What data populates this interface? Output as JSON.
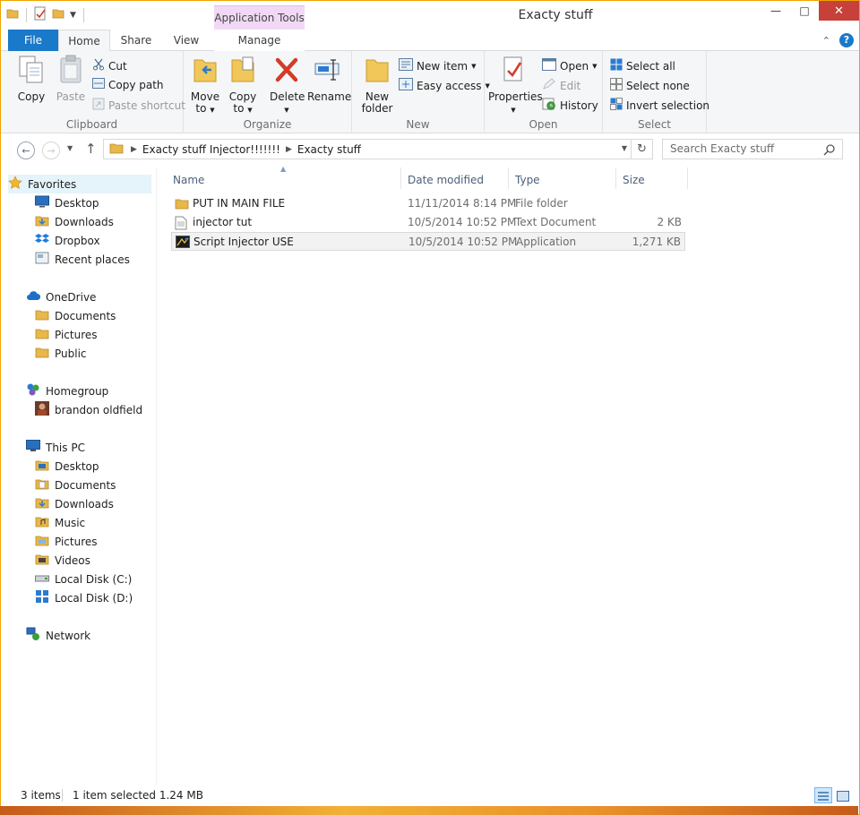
{
  "window": {
    "title": "Exacty stuff",
    "context_tab_group": "Application Tools"
  },
  "tabs": {
    "file": "File",
    "home": "Home",
    "share": "Share",
    "view": "View",
    "manage": "Manage"
  },
  "ribbon": {
    "clipboard": {
      "label": "Clipboard",
      "copy": "Copy",
      "paste": "Paste",
      "cut": "Cut",
      "copy_path": "Copy path",
      "paste_shortcut": "Paste shortcut"
    },
    "organize": {
      "label": "Organize",
      "move_to": "Move",
      "move_to_2": "to",
      "copy_to": "Copy",
      "copy_to_2": "to",
      "delete": "Delete",
      "rename": "Rename"
    },
    "new": {
      "label": "New",
      "new_folder": "New",
      "new_folder_2": "folder",
      "new_item": "New item",
      "easy_access": "Easy access"
    },
    "open": {
      "label": "Open",
      "properties": "Properties",
      "open": "Open",
      "edit": "Edit",
      "history": "History"
    },
    "select": {
      "label": "Select",
      "select_all": "Select all",
      "select_none": "Select none",
      "invert_selection": "Invert selection"
    }
  },
  "address": {
    "crumbs": [
      "Exacty stuff Injector!!!!!!!",
      "Exacty stuff"
    ],
    "search_placeholder": "Search Exacty stuff"
  },
  "sidebar": {
    "favorites": {
      "label": "Favorites",
      "items": [
        "Desktop",
        "Downloads",
        "Dropbox",
        "Recent places"
      ]
    },
    "onedrive": {
      "label": "OneDrive",
      "items": [
        "Documents",
        "Pictures",
        "Public"
      ]
    },
    "homegroup": {
      "label": "Homegroup",
      "items": [
        "brandon oldfield"
      ]
    },
    "thispc": {
      "label": "This PC",
      "items": [
        "Desktop",
        "Documents",
        "Downloads",
        "Music",
        "Pictures",
        "Videos",
        "Local Disk (C:)",
        "Local Disk (D:)"
      ]
    },
    "network": {
      "label": "Network"
    }
  },
  "columns": {
    "name": "Name",
    "date": "Date modified",
    "type": "Type",
    "size": "Size"
  },
  "files": [
    {
      "name": "PUT IN MAIN FILE",
      "date": "11/11/2014 8:14 PM",
      "type": "File folder",
      "size": "",
      "icon": "folder-icon"
    },
    {
      "name": "injector tut",
      "date": "10/5/2014 10:52 PM",
      "type": "Text Document",
      "size": "2 KB",
      "icon": "text-file-icon"
    },
    {
      "name": "Script Injector USE",
      "date": "10/5/2014 10:52 PM",
      "type": "Application",
      "size": "1,271 KB",
      "icon": "application-icon"
    }
  ],
  "status": {
    "count": "3 items",
    "selection": "1 item selected  1.24 MB"
  },
  "colors": {
    "accent": "#1979ca",
    "context_tab": "#f1d9f5",
    "close_button": "#c7403a",
    "folder": "#e8b84a"
  }
}
